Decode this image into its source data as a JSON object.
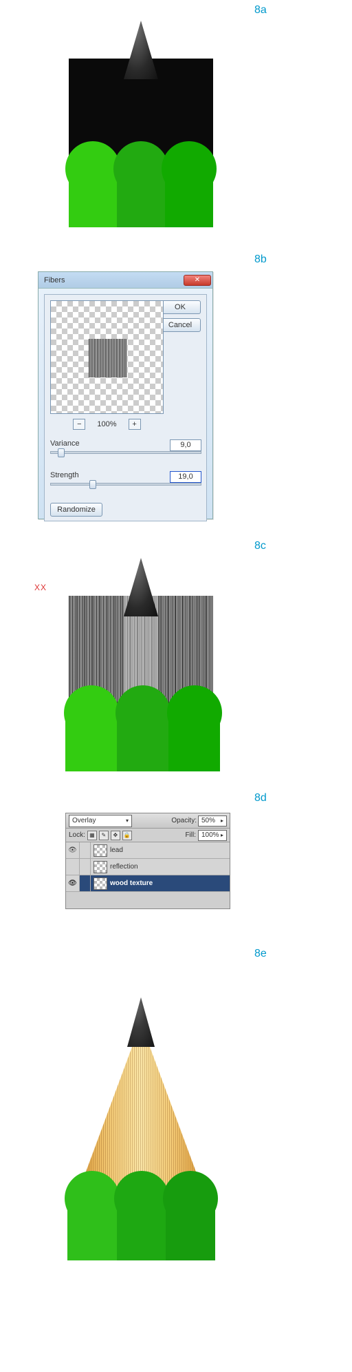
{
  "labels": {
    "a": "8a",
    "b": "8b",
    "c": "8c",
    "d": "8d",
    "e": "8e",
    "xx": "XX"
  },
  "dialog": {
    "title": "Fibers",
    "ok": "OK",
    "cancel": "Cancel",
    "zoom": "100%",
    "variance_label": "Variance",
    "variance_value": "9,0",
    "strength_label": "Strength",
    "strength_value": "19,0",
    "randomize": "Randomize",
    "close_glyph": "✕"
  },
  "layers": {
    "blend_mode": "Overlay",
    "opacity_label": "Opacity:",
    "opacity_value": "50%",
    "lock_label": "Lock:",
    "fill_label": "Fill:",
    "fill_value": "100%",
    "rows": [
      {
        "name": "lead",
        "visible": true,
        "selected": false
      },
      {
        "name": "reflection",
        "visible": false,
        "selected": false
      },
      {
        "name": "wood texture",
        "visible": true,
        "selected": true
      }
    ]
  }
}
